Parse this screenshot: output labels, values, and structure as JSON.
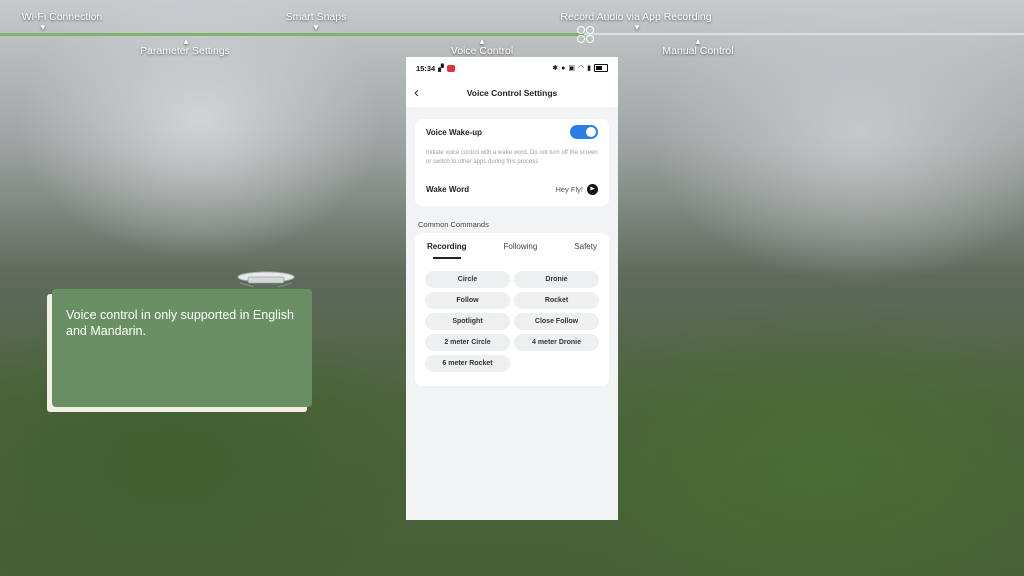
{
  "timeline": {
    "labels_top": [
      "Wi-Fi Connection",
      "Smart Snaps",
      "Record Audio via App Recording"
    ],
    "labels_bottom": [
      "Parameter Settings",
      "Voice Control",
      "Manual Control"
    ],
    "progress": 0.57
  },
  "callout": {
    "text": "Voice control in only supported in English and Mandarin."
  },
  "phone": {
    "status": {
      "time": "15:34"
    },
    "nav_title": "Voice Control Settings",
    "wake": {
      "label": "Voice Wake-up",
      "enabled": true,
      "description": "Initiate voice control with a wake word. Do not turn off the screen or switch to other apps during this process"
    },
    "wake_word": {
      "label": "Wake Word",
      "value": "Hey Fly!"
    },
    "commands_title": "Common Commands",
    "tabs": [
      "Recording",
      "Following",
      "Safety"
    ],
    "active_tab": "Recording",
    "chips": [
      "Circle",
      "Dronie",
      "Follow",
      "Rocket",
      "Spotlight",
      "Close Follow",
      "2 meter Circle",
      "4 meter Dronie",
      "6 meter Rocket"
    ]
  },
  "colors": {
    "toggle_on": "#2b7de9",
    "callout_bg": "#6b8f64",
    "progress": "#86b06a"
  }
}
